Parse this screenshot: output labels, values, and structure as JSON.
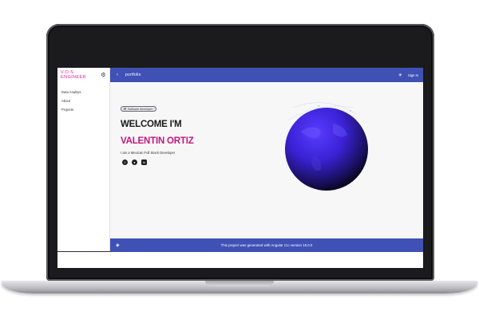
{
  "sidebar": {
    "brand": "V.O.S. ENGINEER",
    "items": [
      {
        "label": "Data Analitys"
      },
      {
        "label": "About"
      },
      {
        "label": "Projects"
      }
    ]
  },
  "topbar": {
    "title": "portfolio",
    "sign_in": "Sign In"
  },
  "hero": {
    "chip": "Software developer",
    "welcome": "WELCOME I'M",
    "name": "VALENTIN ORTIZ",
    "tagline": "I am a Mexican Full Stack Developer"
  },
  "socials": [
    "facebook-icon",
    "github-icon",
    "linkedin-icon"
  ],
  "footer": {
    "text": "This project was generated with Angular CLI version 15.0.0"
  },
  "colors": {
    "primary": "#3f51b5",
    "accent": "#c2187d",
    "brand": "#d81b9f"
  }
}
